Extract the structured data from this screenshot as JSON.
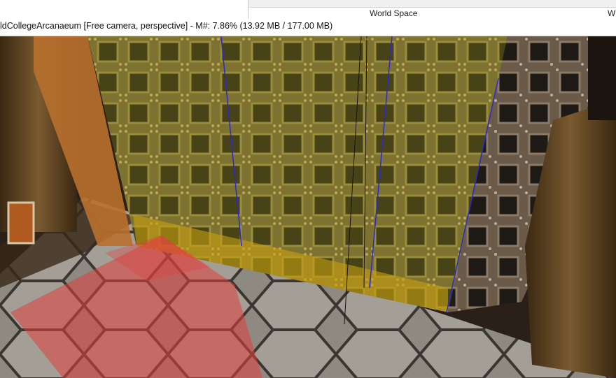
{
  "background_window": {
    "column_headers": [
      "World Space",
      "W"
    ]
  },
  "viewport": {
    "title": "ldCollegeArcanaeum [Free camera, perspective] - M#: 7.86% (13.92 MB / 177.00 MB)"
  },
  "colors": {
    "selection_highlight": "#e04040",
    "edge_highlight": "#2a2acc",
    "wall_tint": "#8a7a3a"
  }
}
